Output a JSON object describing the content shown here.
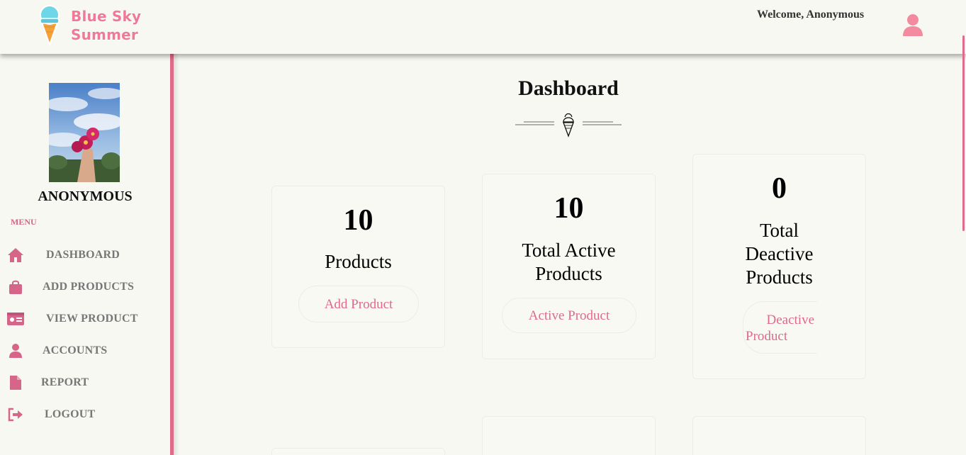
{
  "header": {
    "brand_line1": "Blue Sky",
    "brand_line2": "Summer",
    "welcome": "Welcome, Anonymous",
    "logo_icon": "ice-cream-cone-icon",
    "user_icon": "user-icon"
  },
  "sidebar": {
    "profile_name": "ANONYMOUS",
    "menu_label": "MENU",
    "items": [
      {
        "label": "DASHBOARD",
        "icon": "home-icon"
      },
      {
        "label": "ADD PRODUCTS",
        "icon": "shopping-bag-icon"
      },
      {
        "label": "VIEW PRODUCT",
        "icon": "id-card-icon"
      },
      {
        "label": "ACCOUNTS",
        "icon": "user-icon"
      },
      {
        "label": "REPORT",
        "icon": "file-icon"
      },
      {
        "label": "LOGOUT",
        "icon": "sign-out-icon"
      }
    ]
  },
  "main": {
    "title": "Dashboard",
    "divider_icon": "ice-cream-icon",
    "cards": [
      {
        "value": "10",
        "label": "Products",
        "button": "Add Product"
      },
      {
        "value": "10",
        "label_line1": "Total Active",
        "label_line2": "Products",
        "button": "Active Product"
      },
      {
        "value": "0",
        "label_line1": "Total",
        "label_line2": "Deactive",
        "label_line3": "Products",
        "button_line1": "Deactive",
        "button_line2": "Product"
      }
    ]
  },
  "colors": {
    "accent": "#e06a87",
    "brand": "#f07a96",
    "background": "#f6f8f1"
  }
}
